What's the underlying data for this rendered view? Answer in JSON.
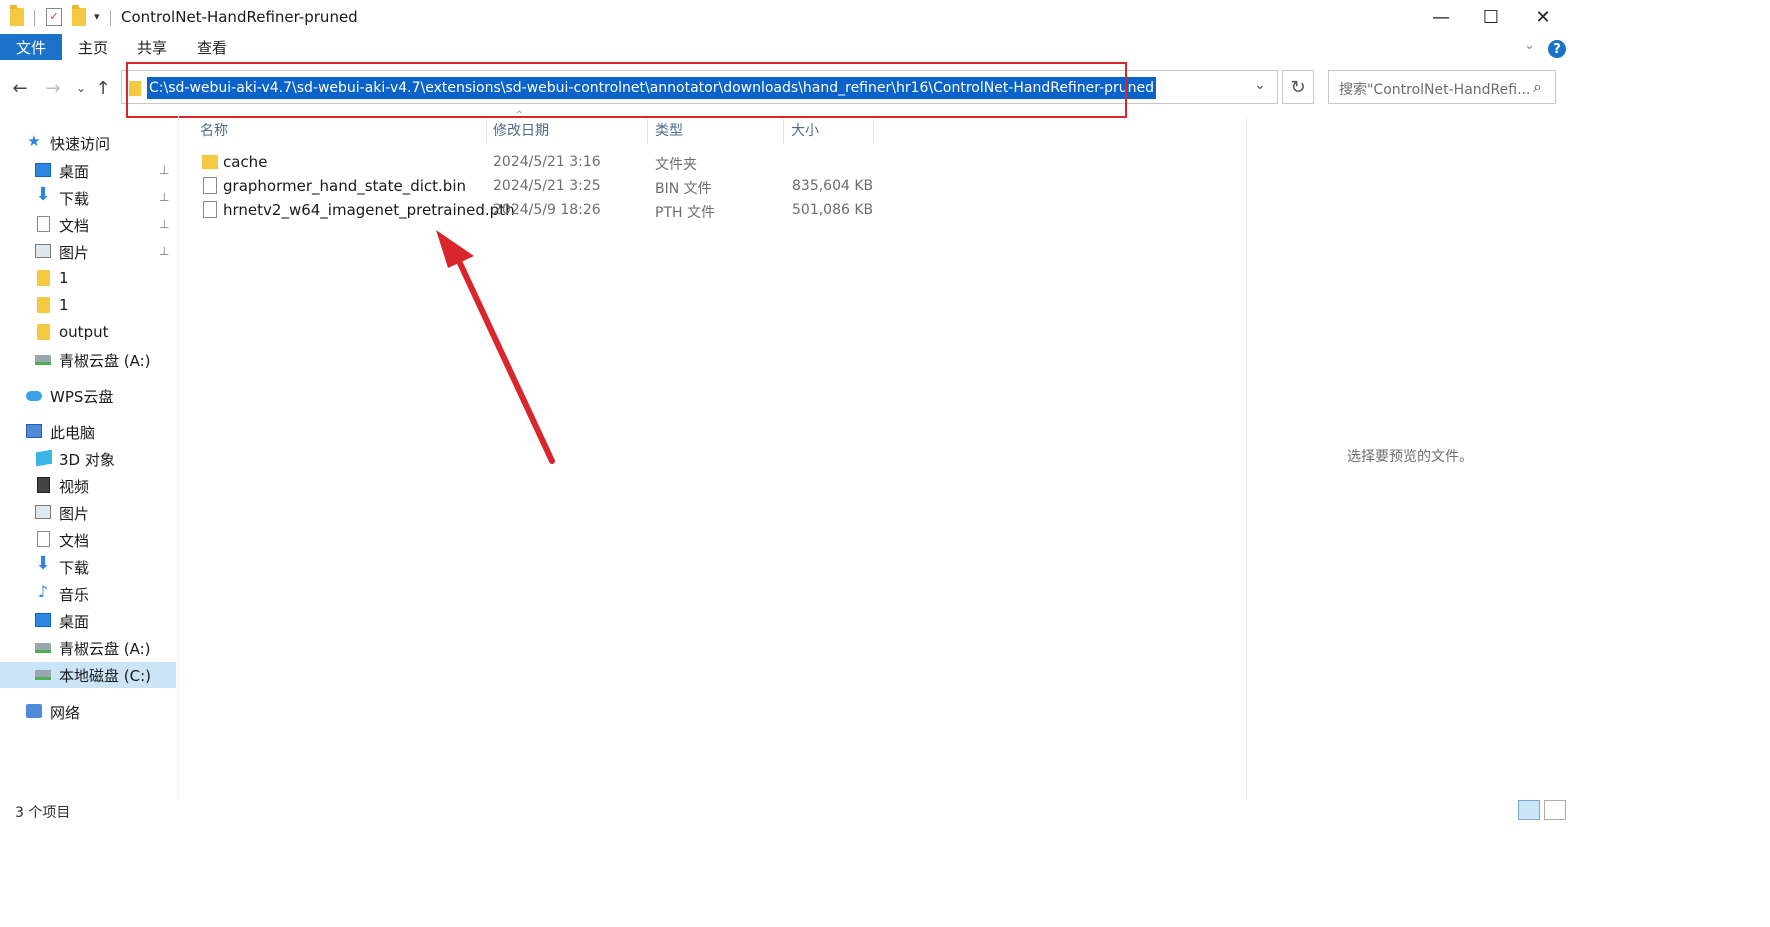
{
  "window": {
    "title": "ControlNet-HandRefiner-pruned",
    "minimize": "—",
    "maximize": "☐",
    "close": "✕"
  },
  "ribbon": {
    "tabs": [
      "文件",
      "主页",
      "共享",
      "查看"
    ],
    "help": "?",
    "collapse": "⌄"
  },
  "nav": {
    "back": "←",
    "forward": "→",
    "recent": "⌄",
    "up": "↑",
    "address": "C:\\sd-webui-aki-v4.7\\sd-webui-aki-v4.7\\extensions\\sd-webui-controlnet\\annotator\\downloads\\hand_refiner\\hr16\\ControlNet-HandRefiner-pruned",
    "address_dropdown": "⌄",
    "refresh": "↻",
    "search_placeholder": "搜索\"ControlNet-HandRefi...",
    "search_icon": "⌕"
  },
  "sidebar": {
    "quick_access": "快速访问",
    "quick_items": [
      {
        "label": "桌面",
        "icon": "desktop-icon",
        "pinned": true
      },
      {
        "label": "下载",
        "icon": "download-icon",
        "pinned": true
      },
      {
        "label": "文档",
        "icon": "document-icon",
        "pinned": true
      },
      {
        "label": "图片",
        "icon": "pictures-icon",
        "pinned": true
      },
      {
        "label": "1",
        "icon": "folder-icon",
        "pinned": false
      },
      {
        "label": "1",
        "icon": "folder-icon",
        "pinned": false
      },
      {
        "label": "output",
        "icon": "folder-icon",
        "pinned": false
      },
      {
        "label": "青椒云盘 (A:)",
        "icon": "drive-icon",
        "pinned": false
      }
    ],
    "wps": "WPS云盘",
    "this_pc": "此电脑",
    "pc_items": [
      {
        "label": "3D 对象",
        "icon": "3d-objects-icon"
      },
      {
        "label": "视频",
        "icon": "video-icon"
      },
      {
        "label": "图片",
        "icon": "pictures-icon"
      },
      {
        "label": "文档",
        "icon": "document-icon"
      },
      {
        "label": "下载",
        "icon": "download-icon"
      },
      {
        "label": "音乐",
        "icon": "music-icon"
      },
      {
        "label": "桌面",
        "icon": "desktop-icon"
      },
      {
        "label": "青椒云盘 (A:)",
        "icon": "drive-icon"
      },
      {
        "label": "本地磁盘 (C:)",
        "icon": "local-disk-icon",
        "selected": true
      }
    ],
    "network": "网络",
    "pin_glyph": "📌"
  },
  "filelist": {
    "columns": [
      "名称",
      "修改日期",
      "类型",
      "大小"
    ],
    "rows": [
      {
        "name": "cache",
        "date": "2024/5/21 3:16",
        "type": "文件夹",
        "size": "",
        "kind": "folder"
      },
      {
        "name": "graphormer_hand_state_dict.bin",
        "date": "2024/5/21 3:25",
        "type": "BIN 文件",
        "size": "835,604 KB",
        "kind": "file"
      },
      {
        "name": "hrnetv2_w64_imagenet_pretrained.pth",
        "date": "2024/5/9 18:26",
        "type": "PTH 文件",
        "size": "501,086 KB",
        "kind": "file"
      }
    ]
  },
  "preview": {
    "empty_text": "选择要预览的文件。"
  },
  "status": {
    "item_count": "3 个项目"
  },
  "colors": {
    "accent": "#1a73c9",
    "selection": "#0b63c9",
    "annotation": "#d9262c",
    "folder": "#f5c842"
  }
}
